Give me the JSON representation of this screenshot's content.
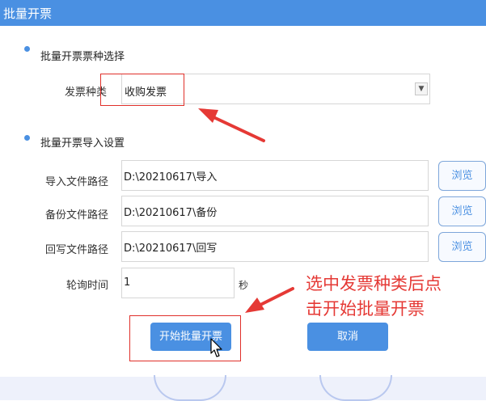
{
  "window": {
    "title": "批量开票"
  },
  "section_invoice_type": {
    "heading": "批量开票票种选择"
  },
  "invoice_type": {
    "label": "发票种类",
    "selected": "收购发票"
  },
  "section_import": {
    "heading": "批量开票导入设置"
  },
  "import_path": {
    "label": "导入文件路径",
    "value": "D:\\20210617\\导入",
    "browse_label": "浏览"
  },
  "backup_path": {
    "label": "备份文件路径",
    "value": "D:\\20210617\\备份",
    "browse_label": "浏览"
  },
  "writeback_path": {
    "label": "回写文件路径",
    "value": "D:\\20210617\\回写",
    "browse_label": "浏览"
  },
  "poll_interval": {
    "label": "轮询时间",
    "value": "1",
    "unit": "秒"
  },
  "actions": {
    "start_label": "开始批量开票",
    "cancel_label": "取消"
  },
  "annotation": {
    "line1": "选中发票种类后点",
    "line2": "击开始批量开票",
    "color": "#e53935"
  },
  "colors": {
    "accent": "#4a90e2",
    "highlight_box": "#e0302a"
  }
}
